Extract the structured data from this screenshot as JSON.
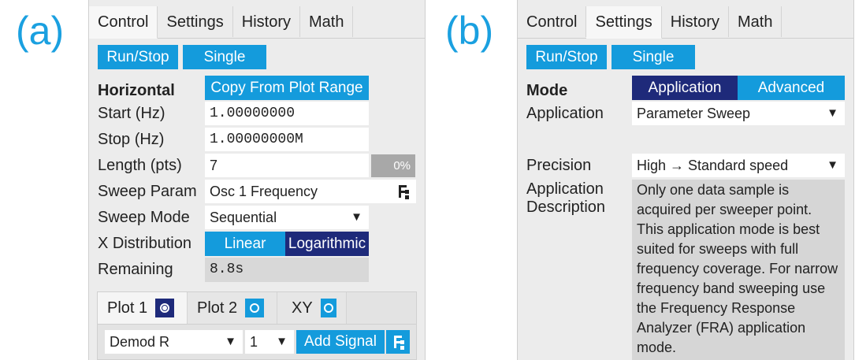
{
  "panel_a": {
    "letter": "(a)",
    "tabs": [
      "Control",
      "Settings",
      "History",
      "Math"
    ],
    "run_stop": "Run/Stop",
    "single": "Single",
    "horizontal_label": "Horizontal",
    "copy_button": "Copy From Plot Range",
    "start_label": "Start (Hz)",
    "start_value": "1.00000000",
    "stop_label": "Stop (Hz)",
    "stop_value": "1.00000000M",
    "length_label": "Length (pts)",
    "length_value": "7",
    "progress": "0%",
    "sweep_param_label": "Sweep Param",
    "sweep_param_value": "Osc 1 Frequency",
    "sweep_mode_label": "Sweep Mode",
    "sweep_mode_value": "Sequential",
    "xdist_label": "X Distribution",
    "xdist_linear": "Linear",
    "xdist_log": "Logarithmic",
    "remaining_label": "Remaining",
    "remaining_value": "8.8s",
    "plot_tabs": [
      "Plot 1",
      "Plot 2",
      "XY"
    ],
    "signal_value": "Demod R",
    "channel_value": "1",
    "add_signal": "Add Signal"
  },
  "panel_b": {
    "letter": "(b)",
    "tabs": [
      "Control",
      "Settings",
      "History",
      "Math"
    ],
    "run_stop": "Run/Stop",
    "single": "Single",
    "mode_label": "Mode",
    "mode_application": "Application",
    "mode_advanced": "Advanced",
    "application_label": "Application",
    "application_value": "Parameter Sweep",
    "precision_label": "Precision",
    "precision_value": "High → Standard speed",
    "desc_label_1": "Application",
    "desc_label_2": "Description",
    "description_lines": [
      "Only one data sample is",
      "acquired per sweeper point.",
      "This application mode is best",
      "suited for sweeps with full",
      "frequency coverage. For narrow",
      "frequency band sweeping use",
      "the Frequency Response",
      "Analyzer (FRA) application",
      "mode."
    ]
  },
  "icons": {
    "dropdown": "triangle-down",
    "tree": "tree-icon",
    "radio": "radio-icon"
  },
  "colors": {
    "accent": "#149bdc",
    "dark": "#1e2a7a",
    "panel": "#ececec"
  }
}
